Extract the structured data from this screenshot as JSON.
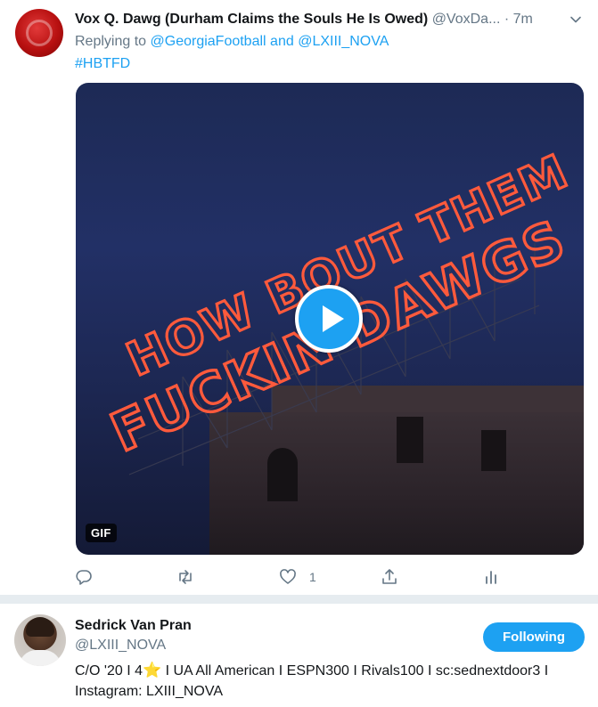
{
  "tweet": {
    "display_name": "Vox Q. Dawg (Durham Claims the Souls He Is Owed)",
    "handle": "@VoxDa...",
    "separator": "·",
    "time": "7m",
    "replying_prefix": "Replying to",
    "reply_user_1": "@GeorgiaFootball",
    "reply_and": "and",
    "reply_user_2": "@LXIII_NOVA",
    "hashtag": "#HBTFD",
    "media": {
      "sign_line_1": "HOW BOUT THEM",
      "sign_line_2": "FUCKIN DAWGS",
      "badge": "GIF",
      "sign_color": "#ff5a3c"
    },
    "actions": {
      "reply_icon": "reply-icon",
      "retweet_icon": "retweet-icon",
      "like_icon": "heart-icon",
      "like_count": "1",
      "share_icon": "share-icon",
      "analytics_icon": "analytics-icon"
    }
  },
  "profile_card": {
    "name": "Sedrick Van Pran",
    "handle": "@LXIII_NOVA",
    "follow_label": "Following",
    "bio_part_1": "C/O '20 I 4",
    "bio_star": "⭐",
    "bio_part_2": " I UA All American I ESPN300 I Rivals100 I sc:sednextdoor3 I Instagram: LXIII_NOVA"
  },
  "colors": {
    "accent": "#1da1f2",
    "secondary_text": "#657786",
    "divider": "#e6ecf0"
  }
}
